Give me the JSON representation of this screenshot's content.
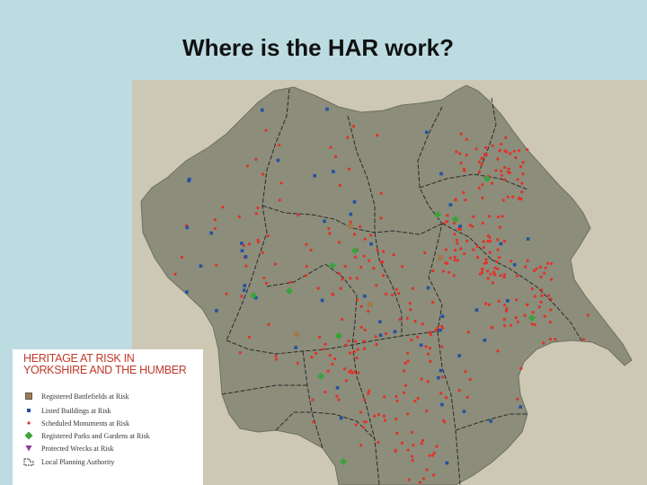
{
  "slide": {
    "title": "Where is the HAR work?"
  },
  "legend": {
    "title_lines": [
      "HERITAGE AT RISK IN",
      "YORKSHIRE AND THE HUMBER"
    ],
    "items": [
      {
        "label": "Registered Battlefields at Risk",
        "icon": "battlefield-square-icon",
        "color": "#a07a4e"
      },
      {
        "label": "Listed Buildings at Risk",
        "icon": "listed-building-square-icon",
        "color": "#2251a3"
      },
      {
        "label": "Scheduled Monuments at Risk",
        "icon": "monument-dot-icon",
        "color": "#e0332a"
      },
      {
        "label": "Registered Parks and Gardens at Risk",
        "icon": "park-diamond-icon",
        "color": "#3aa33c"
      },
      {
        "label": "Protected Wrecks at Risk",
        "icon": "wreck-triangle-icon",
        "color": "#8a3f94"
      },
      {
        "label": "Local Planning Authority",
        "icon": "authority-boundary-icon",
        "color": "#222222"
      }
    ]
  },
  "map": {
    "colors": {
      "sea": "#cdc8b4",
      "land": "#8c8d7b",
      "boundary": "#2a2a2a"
    }
  }
}
